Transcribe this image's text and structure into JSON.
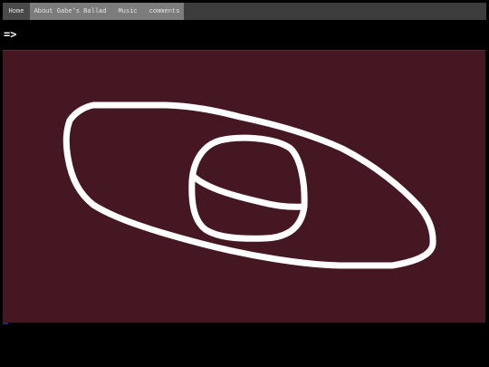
{
  "nav": {
    "items": [
      {
        "label": "Home"
      },
      {
        "label": "About Gabe's Ballad"
      },
      {
        "label": "Music"
      },
      {
        "label": "comments"
      }
    ]
  },
  "arrow_link": {
    "label": "=>"
  },
  "drawing": {
    "background_color": "#451722",
    "stroke_color": "#ffffff"
  }
}
